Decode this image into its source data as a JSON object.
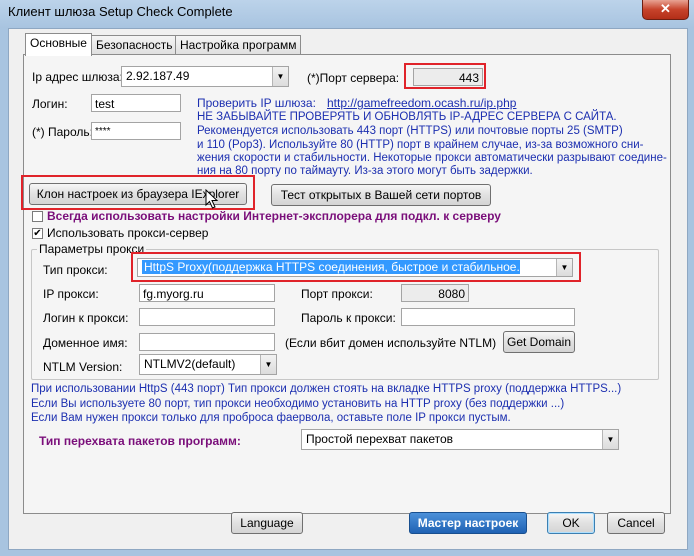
{
  "window": {
    "title": "Клиент шлюза  Setup Check Complete",
    "close_glyph": "✕"
  },
  "tabs": [
    {
      "label": "Основные"
    },
    {
      "label": "Безопасность"
    },
    {
      "label": "Настройка программ"
    }
  ],
  "gateway": {
    "ip_label": "Ip адрес шлюза:",
    "ip_value": "2.92.187.49",
    "login_label": "Логин:",
    "login_value": "test",
    "password_label": "(*) Пароль:",
    "password_value": "****",
    "port_label": "(*)Порт сервера:",
    "port_value": "443",
    "check_ip_label": "Проверить IP шлюза:",
    "check_ip_url": "http://gamefreedom.ocash.ru/ip.php"
  },
  "notice": {
    "line1": "НЕ ЗАБЫВАЙТЕ ПРОВЕРЯТЬ И ОБНОВЛЯТЬ IP-АДРЕС СЕРВЕРА С САЙТА.",
    "line2": "Рекомендуется использовать 443 порт (HTTPS) или почтовые порты 25 (SMTP)",
    "line3": "и 110 (Pop3). Используйте 80 (HTTP) порт в крайнем случае, из-за возможного сни-",
    "line4": "жения скорости и стабильности. Некоторые прокси автоматически разрывают соедине-",
    "line5": "ния на 80 порту по таймауту. Из-за этого могут быть задержки."
  },
  "buttons": {
    "clone": "Клон настроек из браузера IExplorer",
    "test_ports": "Тест открытых в Вашей сети портов",
    "get_domain": "Get Domain",
    "language": "Language",
    "wizard": "Мастер настроек",
    "ok": "OK",
    "cancel": "Cancel"
  },
  "checkboxes": {
    "ie_settings": {
      "label": "Всегда использовать настройки Интернет-эксплорера для подкл. к серверу",
      "checked": false
    },
    "use_proxy": {
      "label": "Использовать прокси-сервер",
      "checked": true
    },
    "check_glyph": "✔"
  },
  "proxy": {
    "group_label": "Параметры прокси",
    "type_label": "Тип прокси:",
    "type_value": "HttpS Proxy(поддержка HTTPS соединения, быстрое и стабильное. Рекомендует",
    "ip_label": "IP прокси:",
    "ip_value": "fg.myorg.ru",
    "port_label": "Порт прокси:",
    "port_value": "8080",
    "login_label": "Логин к прокси:",
    "login_value": "",
    "password_label": "Пароль к прокси:",
    "password_value": "",
    "domain_label": "Доменное имя:",
    "domain_value": "",
    "domain_hint": "(Если вбит домен используйте NTLM)",
    "ntlm_label": "NTLM Version:",
    "ntlm_value": "NTLMV2(default)"
  },
  "info": {
    "line1": "При использовании HttpS (443 порт) Тип прокси должен стоять на вкладке HTTPS proxy (поддержка HTTPS...)",
    "line2": "Если Вы используете  80 порт, тип прокси необходимо установить на HTTP proxy (без поддержки ...)",
    "line3": "Если Вам нужен прокси только для проброса фаервола, оставьте поле IP прокси пустым."
  },
  "intercept": {
    "label": "Тип перехвата пакетов программ:",
    "value": "Простой перехват пакетов"
  },
  "colors": {
    "accent_blue": "#1c2fb0",
    "highlight_red": "#e0232a",
    "purple_label": "#7a0e7a",
    "selection": "#3399ff"
  }
}
